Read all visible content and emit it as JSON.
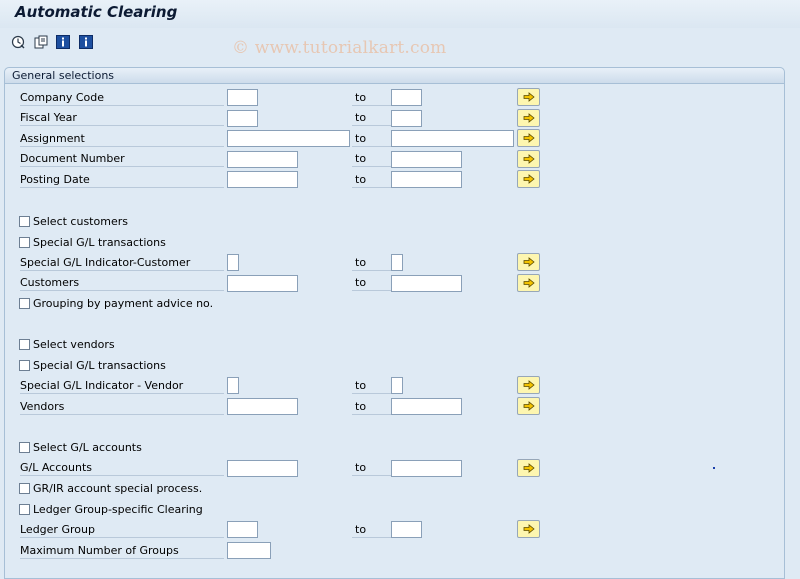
{
  "header": {
    "title": "Automatic Clearing"
  },
  "toolbar": {
    "icons": [
      "execute-icon",
      "variant-icon",
      "info-icon",
      "info-icon"
    ]
  },
  "watermark": "© www.tutorialkart.com",
  "panel": {
    "title": "General selections"
  },
  "to_label": "to",
  "fields": {
    "company_code": "Company Code",
    "fiscal_year": "Fiscal Year",
    "assignment": "Assignment",
    "document_number": "Document Number",
    "posting_date": "Posting Date",
    "select_customers": "Select customers",
    "special_gl_transactions_cust": "Special G/L transactions",
    "special_gl_indicator_customer": "Special G/L Indicator-Customer",
    "customers": "Customers",
    "grouping_payment_advice": "Grouping by payment advice no.",
    "select_vendors": "Select vendors",
    "special_gl_transactions_vend": "Special G/L transactions",
    "special_gl_indicator_vendor": "Special G/L Indicator - Vendor",
    "vendors": "Vendors",
    "select_gl_accounts": "Select G/L accounts",
    "gl_accounts": "G/L Accounts",
    "grir_special": "GR/IR account special process.",
    "ledger_group_clearing": "Ledger Group-specific Clearing",
    "ledger_group": "Ledger Group",
    "max_groups": "Maximum Number of Groups"
  },
  "colors": {
    "background": "#dfeaf4",
    "arrow_button": "#fdf6b0",
    "title": "#0c1a33"
  }
}
